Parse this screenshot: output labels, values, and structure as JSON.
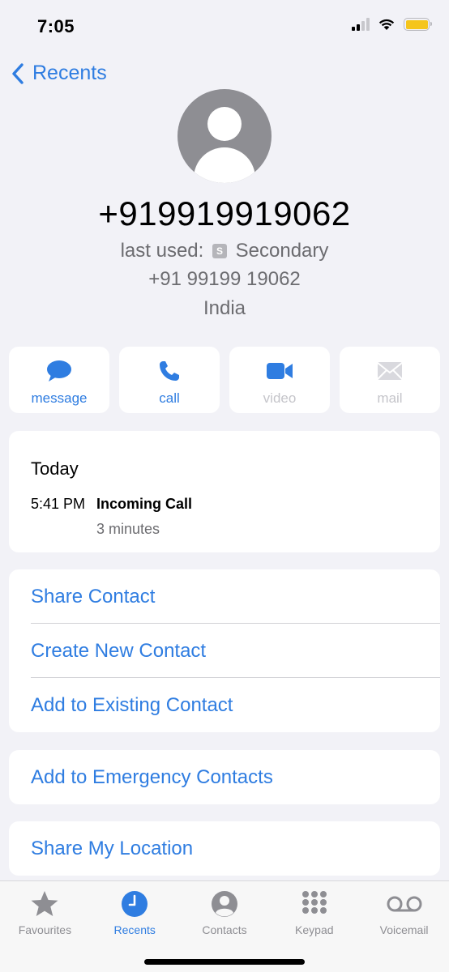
{
  "status": {
    "time": "7:05"
  },
  "nav": {
    "back_label": "Recents"
  },
  "contact": {
    "number": "+919919919062",
    "last_used_prefix": "last used:",
    "sim_badge": "S",
    "sim_name": "Secondary",
    "formatted_number": "+91 99199 19062",
    "country": "India"
  },
  "actions": [
    {
      "label": "message",
      "icon": "message-bubble-icon",
      "enabled": true
    },
    {
      "label": "call",
      "icon": "phone-icon",
      "enabled": true
    },
    {
      "label": "video",
      "icon": "video-camera-icon",
      "enabled": false
    },
    {
      "label": "mail",
      "icon": "envelope-icon",
      "enabled": false
    }
  ],
  "history": {
    "day": "Today",
    "entries": [
      {
        "time": "5:41 PM",
        "type": "Incoming Call",
        "duration": "3 minutes"
      }
    ]
  },
  "options": [
    "Share Contact",
    "Create New Contact",
    "Add to Existing Contact"
  ],
  "emergency_label": "Add to Emergency Contacts",
  "location_label": "Share My Location",
  "tabs": [
    {
      "label": "Favourites",
      "icon": "star-icon",
      "active": false
    },
    {
      "label": "Recents",
      "icon": "clock-icon",
      "active": true
    },
    {
      "label": "Contacts",
      "icon": "person-circle-icon",
      "active": false
    },
    {
      "label": "Keypad",
      "icon": "keypad-icon",
      "active": false
    },
    {
      "label": "Voicemail",
      "icon": "voicemail-icon",
      "active": false
    }
  ],
  "colors": {
    "accent": "#2f7de1",
    "background": "#f2f2f7",
    "disabled": "#c5c5ca",
    "battery": "#f5c51b"
  }
}
